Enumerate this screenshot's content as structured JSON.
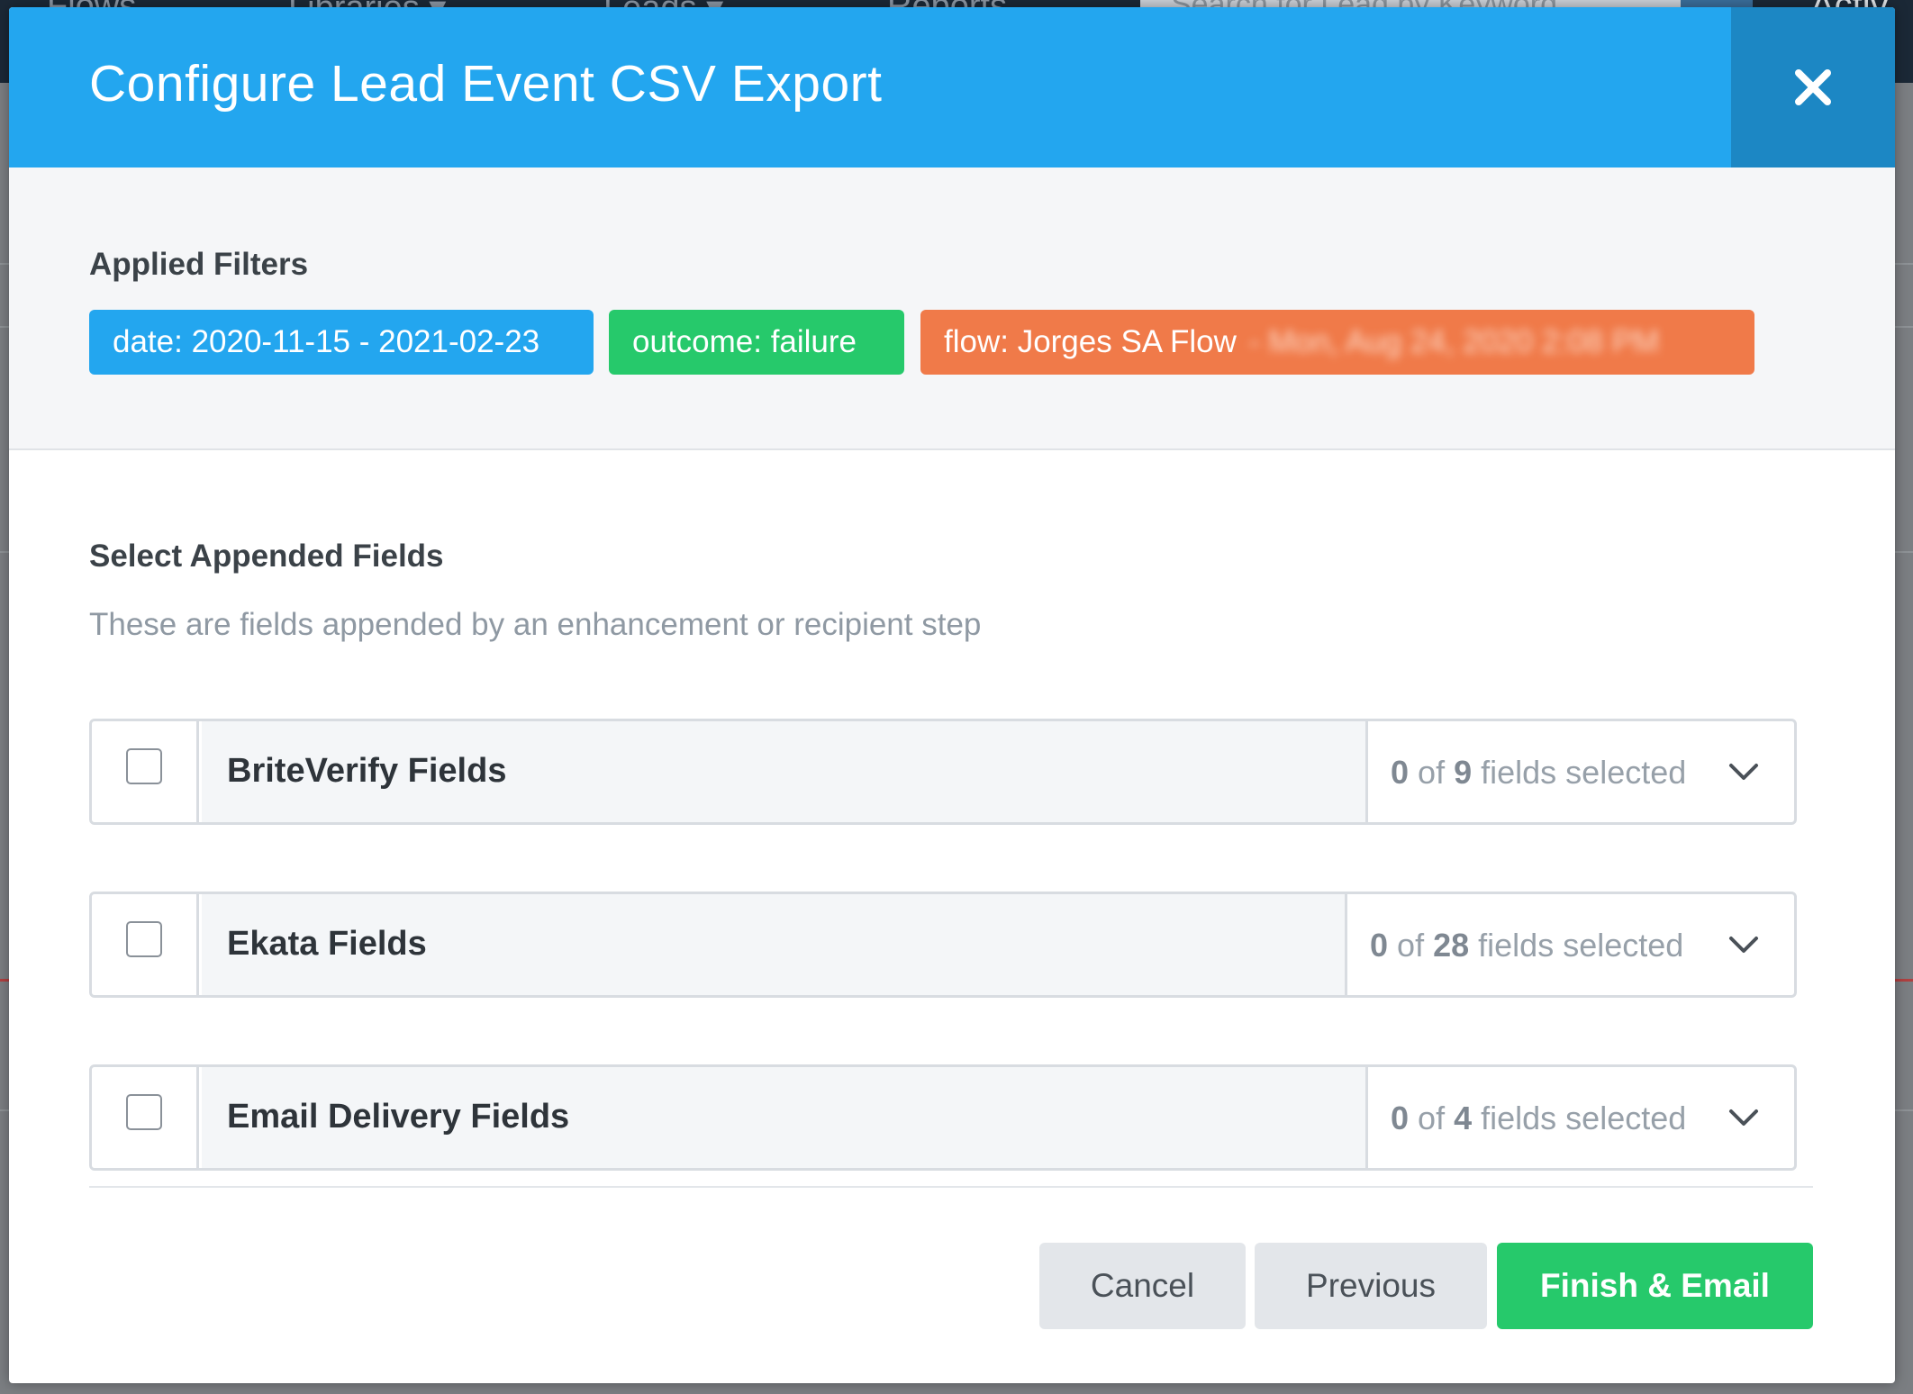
{
  "background": {
    "nav_items": [
      "Flows",
      "Libraries ▾",
      "Leads ▾",
      "Reports"
    ],
    "search_placeholder": "Search for Lead by Keyword",
    "right_text": "Activ"
  },
  "modal": {
    "title": "Configure Lead Event CSV Export",
    "close_label": "✕"
  },
  "filters": {
    "heading": "Applied Filters",
    "chips": [
      {
        "label": "date: 2020-11-15 - 2021-02-23",
        "color": "#23a6ef"
      },
      {
        "label": "outcome: failure",
        "color": "#26c96b"
      },
      {
        "label": "flow: Jorges SA Flow",
        "blurred_suffix": "- Mon, Aug 24, 2020 2:08 PM",
        "color": "#f07a49"
      }
    ]
  },
  "appended": {
    "heading": "Select Appended Fields",
    "description": "These are fields appended by an enhancement or recipient step",
    "groups": [
      {
        "name": "BriteVerify Fields",
        "selected": "0",
        "of": "of",
        "total": "9",
        "suffix": "fields selected"
      },
      {
        "name": "Ekata Fields",
        "selected": "0",
        "of": "of",
        "total": "28",
        "suffix": "fields selected"
      },
      {
        "name": "Email Delivery Fields",
        "selected": "0",
        "of": "of",
        "total": "4",
        "suffix": "fields selected"
      }
    ]
  },
  "footer": {
    "cancel_label": "Cancel",
    "previous_label": "Previous",
    "finish_label": "Finish & Email"
  }
}
